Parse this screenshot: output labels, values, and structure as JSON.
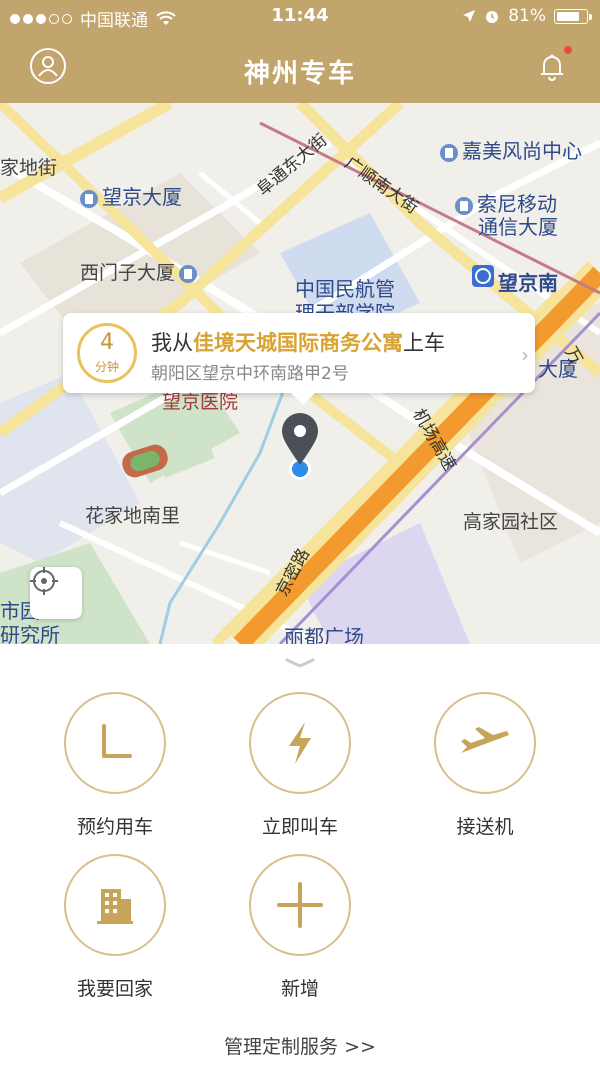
{
  "status_bar": {
    "carrier": "中国联通",
    "time": "11:44",
    "battery_percent": "81%",
    "battery_level": 0.81
  },
  "nav": {
    "title": "神州专车",
    "user_icon": "user-icon",
    "bell_icon": "bell-icon",
    "has_notification": true
  },
  "map": {
    "labels": {
      "jiamei": "嘉美风尚中心",
      "wangjing_dasha": "望京大厦",
      "futong_dongdajie": "阜通东大街",
      "guangshun_nandajie": "广顺南大街",
      "suoni": "索尼移动",
      "suoni2": "通信大厦",
      "ximenzi": "西门子大厦",
      "minhang": "中国民航管",
      "minhang2": "理干部学院",
      "wangjing_nan": "望京南",
      "dasha": "大厦",
      "wanjia": "万",
      "jia_di_jie": "家地街",
      "wangjing_yiyuan": "望京医院",
      "jichang": "机场高速",
      "huajia": "花家地南里",
      "gaojia": "高家园社区",
      "jingmi": "京密路",
      "lidu": "丽都广场",
      "shiyuan": "市园",
      "yanjiusuo": "研究所"
    },
    "locate_icon": "crosshair-icon"
  },
  "pickup": {
    "eta_value": "4",
    "eta_unit": "分钟",
    "prefix": "我从",
    "place": "佳境天城国际商务公寓",
    "suffix": "上车",
    "address": "朝阳区望京中环南路甲2号",
    "chevron": "›"
  },
  "services": [
    {
      "label": "预约用车",
      "icon": "clock-icon"
    },
    {
      "label": "立即叫车",
      "icon": "lightning-icon"
    },
    {
      "label": "接送机",
      "icon": "airplane-icon"
    },
    {
      "label": "我要回家",
      "icon": "building-icon"
    },
    {
      "label": "新增",
      "icon": "plus-icon"
    }
  ],
  "manage_link": "管理定制服务 >>",
  "colors": {
    "brand_gold": "#c2a46d",
    "accent": "#d9a332",
    "icon_gold": "#c8a45a"
  }
}
